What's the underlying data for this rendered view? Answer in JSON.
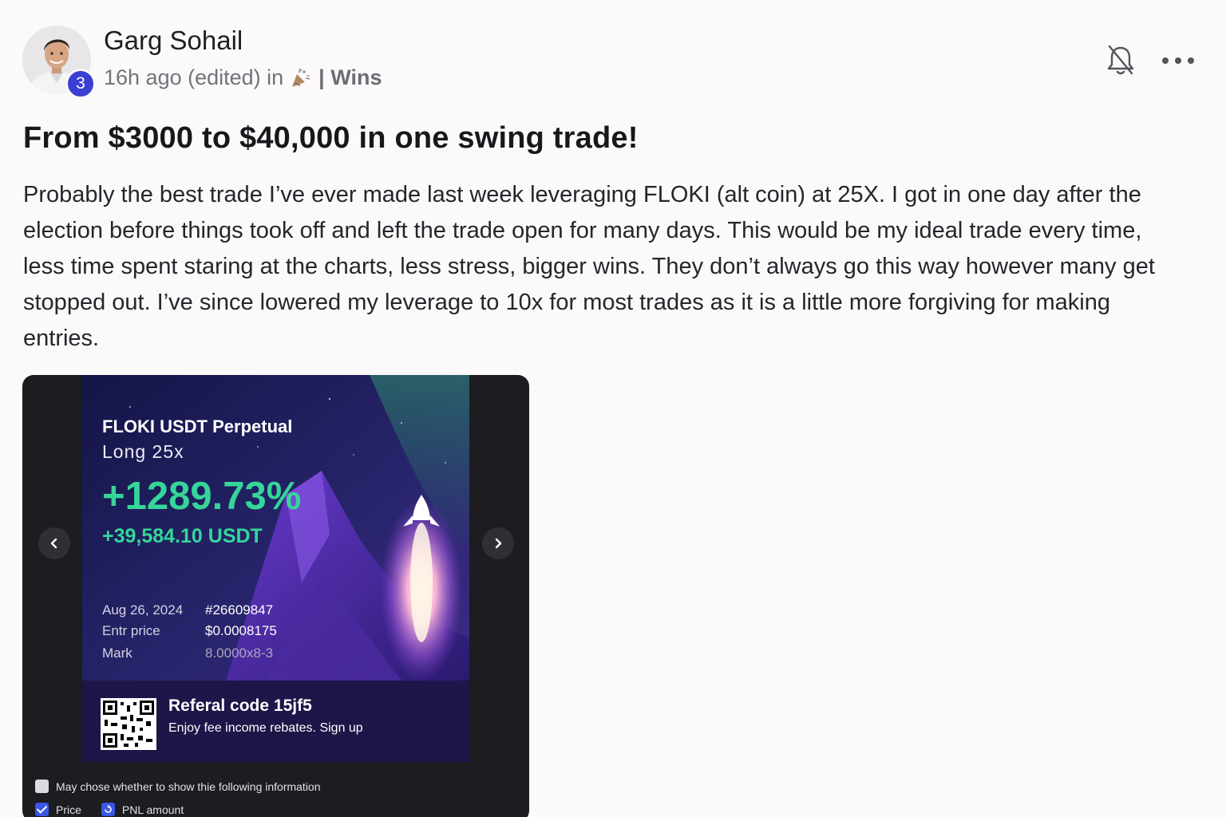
{
  "author": {
    "name": "Garg Sohail",
    "level": "3",
    "timestamp": "16h ago (edited) in",
    "category": "| Wins",
    "category_icon": "party-popper-icon"
  },
  "header_actions": {
    "bell_icon": "bell-off-icon",
    "more_icon": "more-horizontal-icon"
  },
  "post": {
    "title": "From $3000 to $40,000 in one swing trade!",
    "body": "Probably the best trade I’ve ever made last week leveraging FLOKI (alt coin) at 25X. I got in one day after the election before things took off and left the trade open for many days. This would be my ideal trade every time, less time spent staring at the charts, less stress, bigger wins. They don’t always go this way however many get stopped out. I’ve since lowered my leverage to 10x for most trades as it is a little more forgiving for making entries."
  },
  "trade_card": {
    "pair": "FLOKI USDT Perpetual",
    "side": "Long 25x",
    "pnl_percent": "+1289.73%",
    "pnl_amount": "+39,584.10 USDT",
    "date": "Aug 26, 2024",
    "order_id": "#26609847",
    "entry_label": "Entr price",
    "entry_value": "$0.0008175",
    "mark_label": "Mark",
    "mark_value": "8.0000x8-3",
    "referral_code": "Referal code 15jf5",
    "referral_sub": "Enjoy fee income rebates. Sign up",
    "accent_color": "#35d69a"
  },
  "carousel": {
    "prev_icon": "chevron-left-icon",
    "next_icon": "chevron-right-icon"
  },
  "display_options": {
    "header": "May chose whether to show thie following information",
    "price_label": "Price",
    "pnl_label": "PNL amount"
  }
}
